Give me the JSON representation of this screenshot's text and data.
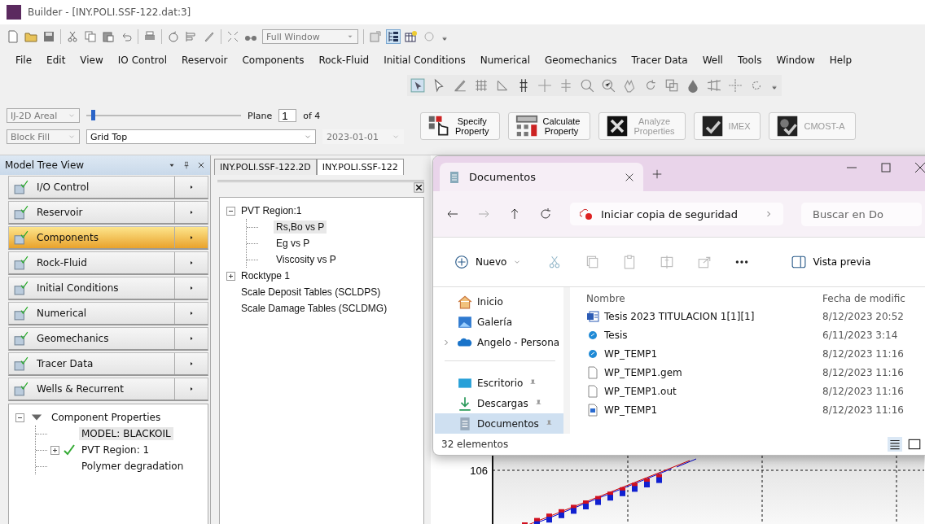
{
  "window": {
    "title": "Builder - [INY.POLI.SSF-122.dat:3]"
  },
  "toolbar": {
    "view_dropdown": "Full Window"
  },
  "menu": [
    "File",
    "Edit",
    "View",
    "IO Control",
    "Reservoir",
    "Components",
    "Rock-Fluid",
    "Initial Conditions",
    "Numerical",
    "Geomechanics",
    "Tracer Data",
    "Well",
    "Tools",
    "Window",
    "Help"
  ],
  "property_bar": {
    "view_mode": "IJ-2D Areal",
    "plane_label": "Plane",
    "plane": "1",
    "plane_of": "of 4",
    "level": 0.03,
    "display": "Block Fill",
    "property": "Grid Top",
    "date": "2023-01-01"
  },
  "action_buttons": [
    {
      "lines": [
        "Specify",
        "Property"
      ],
      "disabled": false,
      "kind": "specify"
    },
    {
      "lines": [
        "Calculate",
        "Property"
      ],
      "disabled": false,
      "kind": "calculate"
    },
    {
      "lines": [
        "Analyze",
        "Properties"
      ],
      "disabled": true,
      "kind": "analyze"
    },
    {
      "lines": [
        "IMEX"
      ],
      "disabled": true,
      "kind": "imex"
    },
    {
      "lines": [
        "CMOST-A"
      ],
      "disabled": true,
      "kind": "cmost"
    }
  ],
  "model_tree": {
    "title": "Model Tree View",
    "sections": [
      {
        "label": "I/O Control",
        "selected": false
      },
      {
        "label": "Reservoir",
        "selected": false
      },
      {
        "label": "Components",
        "selected": true
      },
      {
        "label": "Rock-Fluid",
        "selected": false
      },
      {
        "label": "Initial Conditions",
        "selected": false
      },
      {
        "label": "Numerical",
        "selected": false
      },
      {
        "label": "Geomechanics",
        "selected": false
      },
      {
        "label": "Tracer Data",
        "selected": false
      },
      {
        "label": "Wells & Recurrent",
        "selected": false
      }
    ],
    "tree": [
      {
        "label": "Component Properties",
        "expanded": true,
        "selected": false,
        "checked": false,
        "children": [
          {
            "label": "MODEL: BLACKOIL",
            "selected": true,
            "checked": false
          },
          {
            "label": "PVT Region: 1",
            "expanded": false,
            "selected": false,
            "checked": true
          },
          {
            "label": "Polymer degradation",
            "selected": false,
            "checked": false
          }
        ]
      }
    ]
  },
  "editor": {
    "tabs": [
      {
        "label": "INY.POLI.SSF-122.2D",
        "selected": false
      },
      {
        "label": "INY.POLI.SSF-122",
        "selected": true
      }
    ],
    "tree": [
      {
        "label": "PVT Region:1",
        "expanded": true,
        "selected": false,
        "children": [
          {
            "label": "Rs,Bo vs P",
            "selected": true
          },
          {
            "label": "Eg vs P",
            "selected": false
          },
          {
            "label": "Viscosity vs P",
            "selected": false
          }
        ]
      },
      {
        "label": "Rocktype  1",
        "expanded": false,
        "selected": false
      },
      {
        "label": "Scale Deposit Tables (SCLDPS)",
        "selected": false
      },
      {
        "label": "Scale Damage Tables (SCLDMG)",
        "selected": false
      }
    ]
  },
  "plot": {
    "y_tick": "106"
  },
  "explorer": {
    "tab": "Documentos",
    "breadcrumb": "Iniciar copia de seguridad",
    "search_placeholder": "Buscar en Do",
    "new_button": "Nuevo",
    "preview_button": "Vista previa",
    "nav": [
      {
        "label": "Inicio",
        "kind": "home",
        "selected": false,
        "pinned": false
      },
      {
        "label": "Galería",
        "kind": "gallery",
        "selected": false,
        "pinned": false
      },
      {
        "label": "Angelo - Persona",
        "kind": "cloud",
        "selected": false,
        "pinned": false,
        "expanded": false
      },
      {
        "label": "Escritorio",
        "kind": "desktop",
        "selected": false,
        "pinned": true
      },
      {
        "label": "Descargas",
        "kind": "download",
        "selected": false,
        "pinned": true
      },
      {
        "label": "Documentos",
        "kind": "documents",
        "selected": true,
        "pinned": true
      }
    ],
    "columns": [
      "Nombre",
      "Fecha de modific"
    ],
    "files": [
      {
        "name": "Tesis 2023 TITULACION 1[1][1]",
        "date": "8/12/2023 20:52",
        "kind": "word"
      },
      {
        "name": "Tesis",
        "date": "6/11/2023 3:14",
        "kind": "synced"
      },
      {
        "name": "WP_TEMP1",
        "date": "8/12/2023 11:16",
        "kind": "synced"
      },
      {
        "name": "WP_TEMP1.gem",
        "date": "8/12/2023 11:16",
        "kind": "blank"
      },
      {
        "name": "WP_TEMP1.out",
        "date": "8/12/2023 11:16",
        "kind": "blank"
      },
      {
        "name": "WP_TEMP1",
        "date": "8/12/2023 11:16",
        "kind": "linked"
      }
    ],
    "status": "32 elementos"
  }
}
